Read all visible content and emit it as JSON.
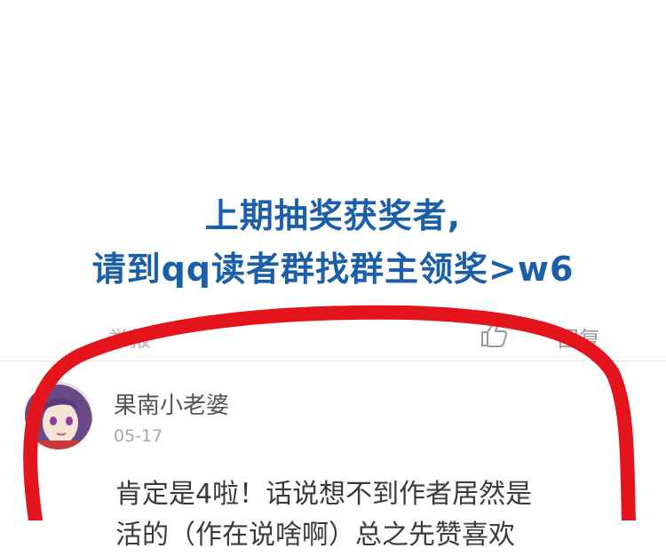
{
  "announcement": {
    "line1": "上期抽奖获奖者,",
    "line2": "请到qq读者群找群主领奖>w6"
  },
  "actions": {
    "report_label": "举报",
    "like_icon": "thumbs-up-icon",
    "reply_label": "回复"
  },
  "comment": {
    "username": "果南小老婆",
    "date": "05-17",
    "text_line1": "肯定是4啦！话说想不到作者居然是",
    "text_line2": "活的（作在说啥啊）总之先赞喜欢"
  },
  "colors": {
    "announcement_blue": "#1a5fa8",
    "marker_red": "#e3141b"
  }
}
